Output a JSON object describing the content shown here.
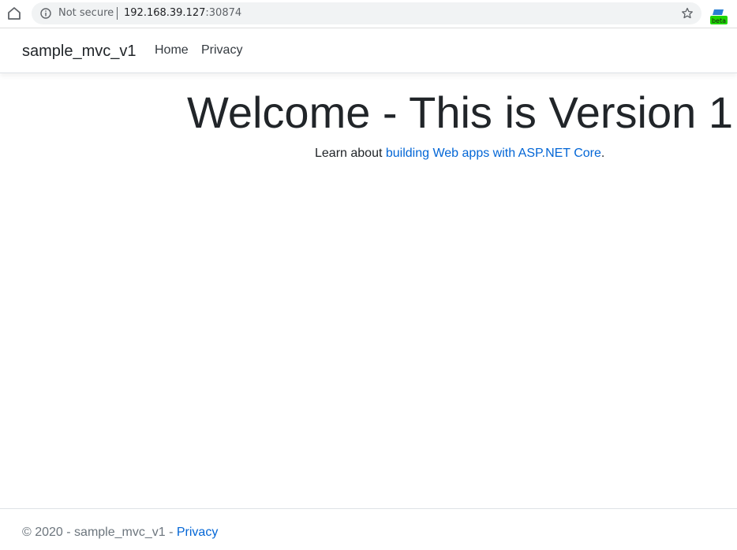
{
  "browser": {
    "security_label": "Not secure",
    "url_host": "192.168.39.127",
    "url_port": ":30874",
    "extension_badge": "beta",
    "icons": [
      "home-icon",
      "info-icon",
      "star-icon",
      "extension-icon"
    ]
  },
  "navbar": {
    "brand": "sample_mvc_v1",
    "links": [
      "Home",
      "Privacy"
    ]
  },
  "main": {
    "headline": "Welcome - This is Version 1",
    "lead_prefix": "Learn about ",
    "lead_link": "building Web apps with ASP.NET Core",
    "lead_suffix": "."
  },
  "footer": {
    "text": "© 2020 - sample_mvc_v1 - ",
    "link": "Privacy"
  },
  "colors": {
    "link": "#0366d6",
    "text": "#212529",
    "muted": "#6c757d",
    "badge_green": "#1fd600"
  }
}
